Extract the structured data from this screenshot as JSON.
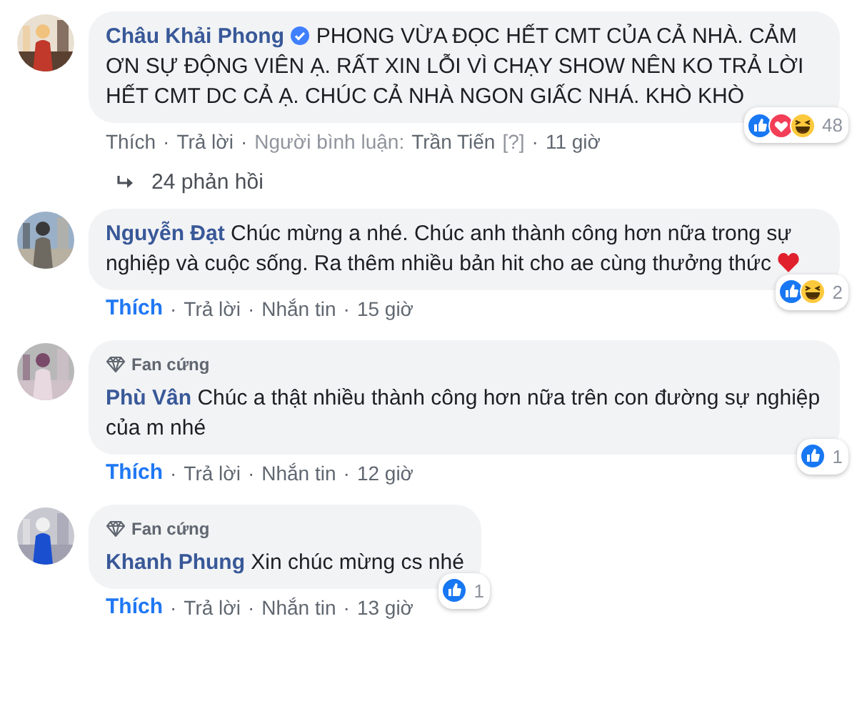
{
  "separator": "·",
  "comments": [
    {
      "author": "Châu Khải Phong",
      "verified": true,
      "text": "PHONG VỪA ĐỌC HẾT CMT CỦA CẢ NHÀ. CẢM ƠN SỰ ĐỘNG VIÊN Ạ. RẤT XIN LỖI VÌ CHẠY SHOW NÊN KO TRẢ LỜI HẾT CMT DC CẢ Ạ. CHÚC CẢ NHÀ NGON GIẤC NHÁ. KHÒ KHÒ",
      "heart": false,
      "like": {
        "label": "Thích",
        "selected": false
      },
      "actions": [
        {
          "kind": "link",
          "label": "Trả lời"
        },
        {
          "kind": "commenter",
          "label": "Người bình luận:",
          "name": "Trần Tiến",
          "hint": "[?]"
        },
        {
          "kind": "time",
          "label": "11 giờ"
        }
      ],
      "reactions": {
        "icons": [
          {
            "kind": "like"
          },
          {
            "kind": "love"
          },
          {
            "kind": "haha"
          }
        ],
        "count": "48"
      },
      "replies": {
        "label": "24 phản hồi"
      }
    },
    {
      "author": "Nguyễn Đạt",
      "verified": false,
      "text": "Chúc mừng a nhé. Chúc anh thành công hơn nữa trong sự nghiệp và cuộc sống. Ra thêm nhiều bản hit cho ae cùng thưởng thức",
      "heart": true,
      "like": {
        "label": "Thích",
        "selected": true
      },
      "actions": [
        {
          "kind": "link",
          "label": "Trả lời"
        },
        {
          "kind": "link",
          "label": "Nhắn tin"
        },
        {
          "kind": "time",
          "label": "15 giờ"
        }
      ],
      "reactions": {
        "icons": [
          {
            "kind": "like"
          },
          {
            "kind": "haha"
          }
        ],
        "count": "2"
      }
    },
    {
      "badge": "Fan cứng",
      "author": "Phù Vân",
      "verified": false,
      "text": "Chúc a thật nhiều thành công hơn nữa trên con đường sự nghiệp của m nhé",
      "heart": false,
      "like": {
        "label": "Thích",
        "selected": true
      },
      "actions": [
        {
          "kind": "link",
          "label": "Trả lời"
        },
        {
          "kind": "link",
          "label": "Nhắn tin"
        },
        {
          "kind": "time",
          "label": "12 giờ"
        }
      ],
      "reactions": {
        "icons": [
          {
            "kind": "like"
          }
        ],
        "count": "1"
      }
    },
    {
      "badge": "Fan cứng",
      "author": "Khanh Phung",
      "verified": false,
      "text": "Xin chúc mừng cs nhé",
      "heart": false,
      "like": {
        "label": "Thích",
        "selected": true
      },
      "actions": [
        {
          "kind": "link",
          "label": "Trả lời"
        },
        {
          "kind": "link",
          "label": "Nhắn tin"
        },
        {
          "kind": "time",
          "label": "13 giờ"
        }
      ],
      "reactions": {
        "icons": [
          {
            "kind": "like"
          }
        ],
        "count": "1"
      }
    }
  ]
}
